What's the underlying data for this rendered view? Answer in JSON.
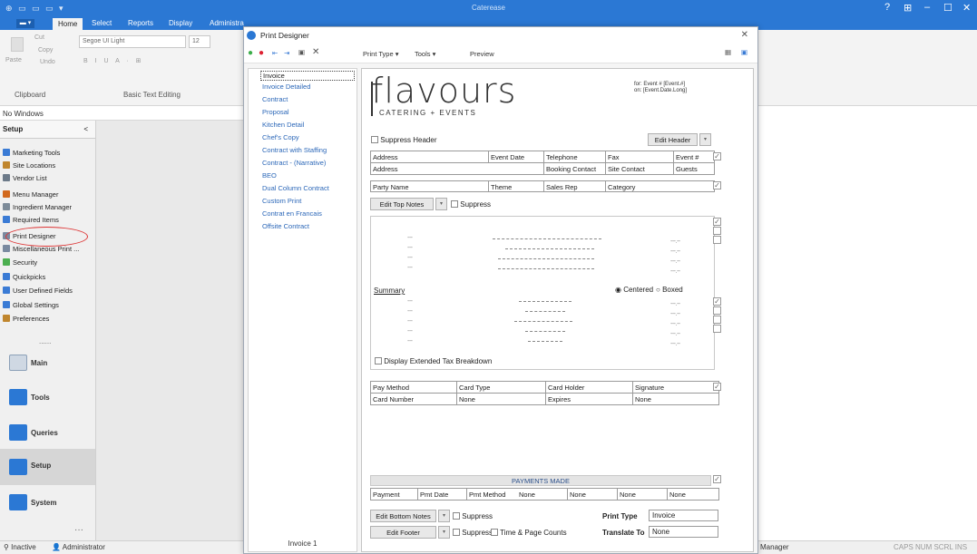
{
  "app": {
    "title": "Caterease",
    "controls": [
      "?",
      "⊞",
      "–",
      "☐",
      "✕"
    ]
  },
  "ribbon": {
    "file_label": "▬ ▾",
    "tabs": [
      "Home",
      "Select",
      "Reports",
      "Display",
      "Administra"
    ],
    "clipboard": {
      "cut": "Cut",
      "copy": "Copy",
      "paste": "Paste",
      "undo": "Undo",
      "group": "Clipboard"
    },
    "font": {
      "name": "Segoe UI Light",
      "size": "12",
      "group": "Basic Text Editing",
      "format_row": "B  I  U  A · ⊞"
    }
  },
  "left": {
    "no_windows": "No Windows",
    "setup_header": "Setup",
    "collapse_glyph": "<",
    "items": [
      {
        "label": "Marketing Tools",
        "color": "#3a7bd5"
      },
      {
        "label": "Site Locations",
        "color": "#c0862e"
      },
      {
        "label": "Vendor List",
        "color": "#6c7a89"
      },
      {
        "label": "Menu Manager",
        "color": "#d2691e"
      },
      {
        "label": "Ingredient Manager",
        "color": "#7d8b99"
      },
      {
        "label": "Required Items",
        "color": "#3a7bd5"
      },
      {
        "label": "Print Designer",
        "color": "#7a8aa0"
      },
      {
        "label": "Miscellaneous Print ...",
        "color": "#7a8aa0"
      },
      {
        "label": "Security",
        "color": "#4caf50"
      },
      {
        "label": "Quickpicks",
        "color": "#3a7bd5"
      },
      {
        "label": "User Defined Fields",
        "color": "#3a7bd5"
      },
      {
        "label": "Global Settings",
        "color": "#3a7bd5"
      },
      {
        "label": "Preferences",
        "color": "#c0862e"
      }
    ],
    "more_dots": "......",
    "big_nav": [
      {
        "label": "Main",
        "color": "#cfd8e3"
      },
      {
        "label": "Tools",
        "color": "#2b78d4"
      },
      {
        "label": "Queries",
        "color": "#2b78d4"
      },
      {
        "label": "Setup",
        "color": "#2b78d4"
      },
      {
        "label": "System",
        "color": "#2b78d4"
      }
    ],
    "bottom_dots": "···"
  },
  "status": {
    "inactive": "Inactive",
    "user": "Administrator",
    "right_text": "Manager",
    "keys": "CAPS  NUM  SCRL  INS"
  },
  "dialog": {
    "title": "Print Designer",
    "close": "✕",
    "toolbar": {
      "print_type": "Print Type ▾",
      "tools": "Tools ▾",
      "preview": "Preview"
    },
    "documents": [
      "Invoice",
      "Invoice Detailed",
      "Contract",
      "Proposal",
      "Kitchen Detail",
      "Chef's Copy",
      "Contract with Staffing",
      "Contract - (Narrative)",
      "BEO",
      "Dual Column Contract",
      "Custom Print",
      "Contrat en Francais",
      "Offsite Contract"
    ],
    "footer_label": "Invoice 1",
    "page": {
      "logo_text": "flavours",
      "logo_sub": "CATERING + EVENTS",
      "for_line": "for: Event #  [Event.#]",
      "on_line": "on:  [Event.Date.Long]",
      "suppress_header": "Suppress Header",
      "edit_header": "Edit Header",
      "grid1": {
        "row1": [
          "Address",
          "Event Date",
          "Telephone",
          "Fax",
          "Event #"
        ],
        "row2": [
          "Address",
          "Booking Contact",
          "Site Contact",
          "Guests"
        ]
      },
      "grid2": [
        "Party Name",
        "Theme",
        "Sales Rep",
        "Category"
      ],
      "edit_top_notes": "Edit Top Notes",
      "suppress": "Suppress",
      "summary": "Summary",
      "centered": "Centered",
      "boxed": "Boxed",
      "extended_tax": "Display Extended Tax Breakdown",
      "pay": {
        "row1": [
          "Pay Method",
          "Card Type",
          "Card Holder",
          "Signature"
        ],
        "row2": [
          "Card Number",
          "None",
          "Expires",
          "None"
        ]
      },
      "payments_made": "PAYMENTS MADE",
      "payments_row": [
        "Payment",
        "Pmt Date",
        "Pmt Method",
        "None",
        "None",
        "None",
        "None"
      ],
      "edit_bottom_notes": "Edit Bottom Notes",
      "edit_footer": "Edit Footer",
      "time_page_counts": "Time & Page Counts",
      "print_type_label": "Print Type",
      "print_type_value": "Invoice",
      "translate_label": "Translate To",
      "translate_value": "None"
    }
  }
}
